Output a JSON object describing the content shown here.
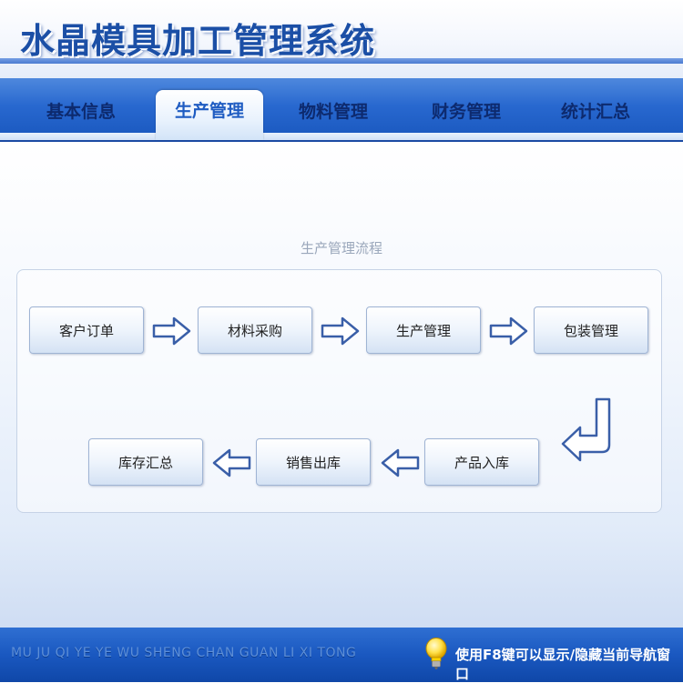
{
  "app": {
    "title": "水晶模具加工管理系统"
  },
  "nav": {
    "tabs": [
      {
        "label": "基本信息"
      },
      {
        "label": "生产管理"
      },
      {
        "label": "物料管理"
      },
      {
        "label": "财务管理"
      },
      {
        "label": "统计汇总"
      }
    ],
    "active_tab": "生产管理"
  },
  "flow": {
    "title": "生产管理流程",
    "steps": [
      {
        "label": "客户订单"
      },
      {
        "label": "材料采购"
      },
      {
        "label": "生产管理"
      },
      {
        "label": "包装管理"
      },
      {
        "label": "产品入库"
      },
      {
        "label": "销售出库"
      },
      {
        "label": "库存汇总"
      }
    ]
  },
  "status": {
    "pinyin": "MU JU QI YE YE WU SHENG CHAN GUAN LI XI TONG",
    "hint": "使用F8键可以显示/隐藏当前导航窗口"
  },
  "colors": {
    "nav_blue": "#2868cf",
    "title_blue": "#1b4fa6",
    "arrow_blue": "#3a5fa8"
  }
}
